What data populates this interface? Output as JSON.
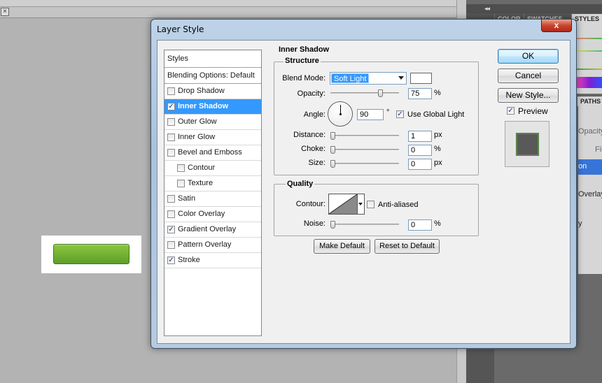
{
  "background": {
    "doc_close_glyph": "×",
    "dock_collapse_glyph": "◂◂",
    "panel_tabs": [
      "COLOR",
      "SWATCHES",
      "STYLES"
    ],
    "panel2_tabs": [
      "PATHS"
    ],
    "panel2_texts": [
      "Opacity",
      "Fil",
      "on",
      "Overlay",
      "y"
    ]
  },
  "dialog": {
    "title": "Layer Style",
    "close_glyph": "x",
    "styles_list": {
      "header": "Styles",
      "blending_options": "Blending Options: Default",
      "items": [
        {
          "label": "Drop Shadow",
          "checked": false,
          "indent": false,
          "selected": false
        },
        {
          "label": "Inner Shadow",
          "checked": true,
          "indent": false,
          "selected": true
        },
        {
          "label": "Outer Glow",
          "checked": false,
          "indent": false,
          "selected": false
        },
        {
          "label": "Inner Glow",
          "checked": false,
          "indent": false,
          "selected": false
        },
        {
          "label": "Bevel and Emboss",
          "checked": false,
          "indent": false,
          "selected": false
        },
        {
          "label": "Contour",
          "checked": false,
          "indent": true,
          "selected": false
        },
        {
          "label": "Texture",
          "checked": false,
          "indent": true,
          "selected": false
        },
        {
          "label": "Satin",
          "checked": false,
          "indent": false,
          "selected": false
        },
        {
          "label": "Color Overlay",
          "checked": false,
          "indent": false,
          "selected": false
        },
        {
          "label": "Gradient Overlay",
          "checked": true,
          "indent": false,
          "selected": false
        },
        {
          "label": "Pattern Overlay",
          "checked": false,
          "indent": false,
          "selected": false
        },
        {
          "label": "Stroke",
          "checked": true,
          "indent": false,
          "selected": false
        }
      ]
    },
    "inner_shadow": {
      "title": "Inner Shadow",
      "structure": {
        "title": "Structure",
        "blend_mode_label": "Blend Mode:",
        "blend_mode_value": "Soft Light",
        "shadow_color": "#ffffff",
        "opacity_label": "Opacity:",
        "opacity_value": "75",
        "opacity_unit": "%",
        "opacity_fraction": 0.75,
        "angle_label": "Angle:",
        "angle_value": "90",
        "angle_unit": "°",
        "use_global_light_label": "Use Global Light",
        "use_global_light": true,
        "distance_label": "Distance:",
        "distance_value": "1",
        "distance_unit": "px",
        "choke_label": "Choke:",
        "choke_value": "0",
        "choke_unit": "%",
        "size_label": "Size:",
        "size_value": "0",
        "size_unit": "px"
      },
      "quality": {
        "title": "Quality",
        "contour_label": "Contour:",
        "anti_aliased_label": "Anti-aliased",
        "anti_aliased": false,
        "noise_label": "Noise:",
        "noise_value": "0",
        "noise_unit": "%"
      },
      "make_default_label": "Make Default",
      "reset_default_label": "Reset to Default"
    },
    "buttons": {
      "ok": "OK",
      "cancel": "Cancel",
      "new_style": "New Style..."
    },
    "preview": {
      "label": "Preview",
      "checked": true
    }
  },
  "colors": {
    "selection": "#3399ff",
    "button_green": "#6aab30",
    "title_bar": "#a9c2dc"
  }
}
